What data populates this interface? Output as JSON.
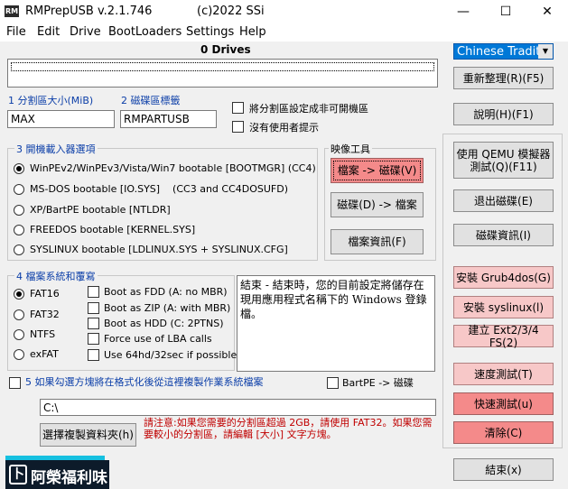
{
  "window": {
    "title": "RMPrepUSB v.2.1.746",
    "copyright": "(c)2022 SSi",
    "icon_text": "RM",
    "minimize": "—",
    "maximize": "☐",
    "close": "✕"
  },
  "menu": [
    "File",
    "Edit",
    "Drive",
    "BootLoaders",
    "Settings",
    "Help"
  ],
  "drives_label": "0 Drives",
  "language": "Chinese Traditi",
  "partition": {
    "size_label": "1 分割區大小(MiB)",
    "size_value": "MAX",
    "volume_label": "2 磁碟區標籤",
    "volume_value": "RMPARTUSB",
    "set_non_bootable": "將分割區設定成非可開機區",
    "no_prompt": "沒有使用者提示"
  },
  "bootloader": {
    "title": "3 開機載入器選項",
    "options": [
      "WinPEv2/WinPEv3/Vista/Win7 bootable [BOOTMGR] (CC4)",
      "MS-DOS bootable [IO.SYS]    (CC3 and CC4DOSUFD)",
      "XP/BartPE bootable [NTLDR]",
      "FREEDOS bootable [KERNEL.SYS]",
      "SYSLINUX bootable [LDLINUX.SYS + SYSLINUX.CFG]"
    ],
    "selected_index": 0
  },
  "image_tools": {
    "title": "映像工具",
    "file_to_drive": "檔案 -> 磁碟(V)",
    "drive_to_file": "磁碟(D) -> 檔案",
    "file_info": "檔案資訊(F)"
  },
  "filesystem": {
    "title": "4 檔案系統和覆寫",
    "types": [
      "FAT16",
      "FAT32",
      "NTFS",
      "exFAT"
    ],
    "selected_index": 0,
    "options": [
      "Boot as FDD (A: no MBR)",
      "Boot as ZIP (A: with MBR)",
      "Boot as HDD (C: 2PTNS)",
      "Force use of LBA calls",
      "Use 64hd/32sec if possible"
    ]
  },
  "notes_text": "結束 - 結束時，您的目前設定將儲存在現用應用程式名稱下的 Windows 登錄檔。",
  "copy_files": {
    "label": "5 如果勾選方塊將在格式化後從這裡複製作業系統檔案",
    "bartpe": "BartPE -> 磁碟",
    "path": "C:\\",
    "choose_folder": "選擇複製資料夾(h)"
  },
  "warning": "請注意:如果您需要的分割區超過 2GB，請使用 FAT32。如果您需要較小的分割區，請編輯 [大小] 文字方塊。",
  "right_buttons": {
    "refresh": "重新整理(R)(F5)",
    "help": "說明(H)(F1)",
    "qemu_1": "使用 QEMU 模擬器",
    "qemu_2": "測試(Q)(F11)",
    "eject": "退出磁碟(E)",
    "drive_info": "磁碟資訊(I)",
    "install_grub4dos": "安裝 Grub4dos(G)",
    "install_syslinux": "安裝 syslinux(l)",
    "create_ext": "建立 Ext2/3/4 FS(2)",
    "speed_test": "速度測試(T)",
    "quick_test": "快速測試(u)",
    "clean": "清除(C)",
    "exit": "結束(x)"
  },
  "logo": {
    "text": "阿榮福利味",
    "mark": "卜"
  },
  "colors": {
    "accent_blue": "#0b3ea8",
    "warning_red": "#c00000",
    "button_pink": "#f7c8c8",
    "button_red": "#f48a8a",
    "select_blue": "#0078d7"
  }
}
